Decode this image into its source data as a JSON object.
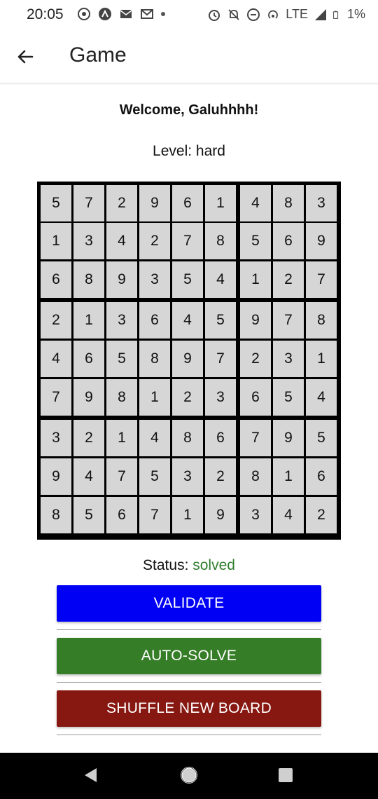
{
  "status_bar": {
    "time": "20:05",
    "network": "LTE",
    "battery": "1%",
    "icons": [
      "whatsapp-icon",
      "app-icon",
      "mail-icon",
      "gmail-icon",
      "dot-icon",
      "alarm-icon",
      "mute-icon",
      "dnd-icon",
      "hotspot-icon",
      "signal-icon",
      "battery-icon"
    ]
  },
  "app_bar": {
    "title": "Game",
    "back_icon": "arrow-back-icon"
  },
  "welcome": "Welcome, Galuhhhh!",
  "level": "Level: hard",
  "board": [
    [
      5,
      7,
      2,
      9,
      6,
      1,
      4,
      8,
      3
    ],
    [
      1,
      3,
      4,
      2,
      7,
      8,
      5,
      6,
      9
    ],
    [
      6,
      8,
      9,
      3,
      5,
      4,
      1,
      2,
      7
    ],
    [
      2,
      1,
      3,
      6,
      4,
      5,
      9,
      7,
      8
    ],
    [
      4,
      6,
      5,
      8,
      9,
      7,
      2,
      3,
      1
    ],
    [
      7,
      9,
      8,
      1,
      2,
      3,
      6,
      5,
      4
    ],
    [
      3,
      2,
      1,
      4,
      8,
      6,
      7,
      9,
      5
    ],
    [
      9,
      4,
      7,
      5,
      3,
      2,
      8,
      1,
      6
    ],
    [
      8,
      5,
      6,
      7,
      1,
      9,
      3,
      4,
      2
    ]
  ],
  "status": {
    "label": "Status:",
    "value": "solved",
    "value_color": "#2f7d2f"
  },
  "buttons": {
    "validate": {
      "label": "VALIDATE",
      "color": "#0000f5"
    },
    "auto_solve": {
      "label": "AUTO-SOLVE",
      "color": "#357d27"
    },
    "shuffle": {
      "label": "SHUFFLE NEW BOARD",
      "color": "#871711"
    }
  },
  "nav_bar": {
    "icons": [
      "nav-back-icon",
      "nav-home-icon",
      "nav-recents-icon"
    ]
  }
}
